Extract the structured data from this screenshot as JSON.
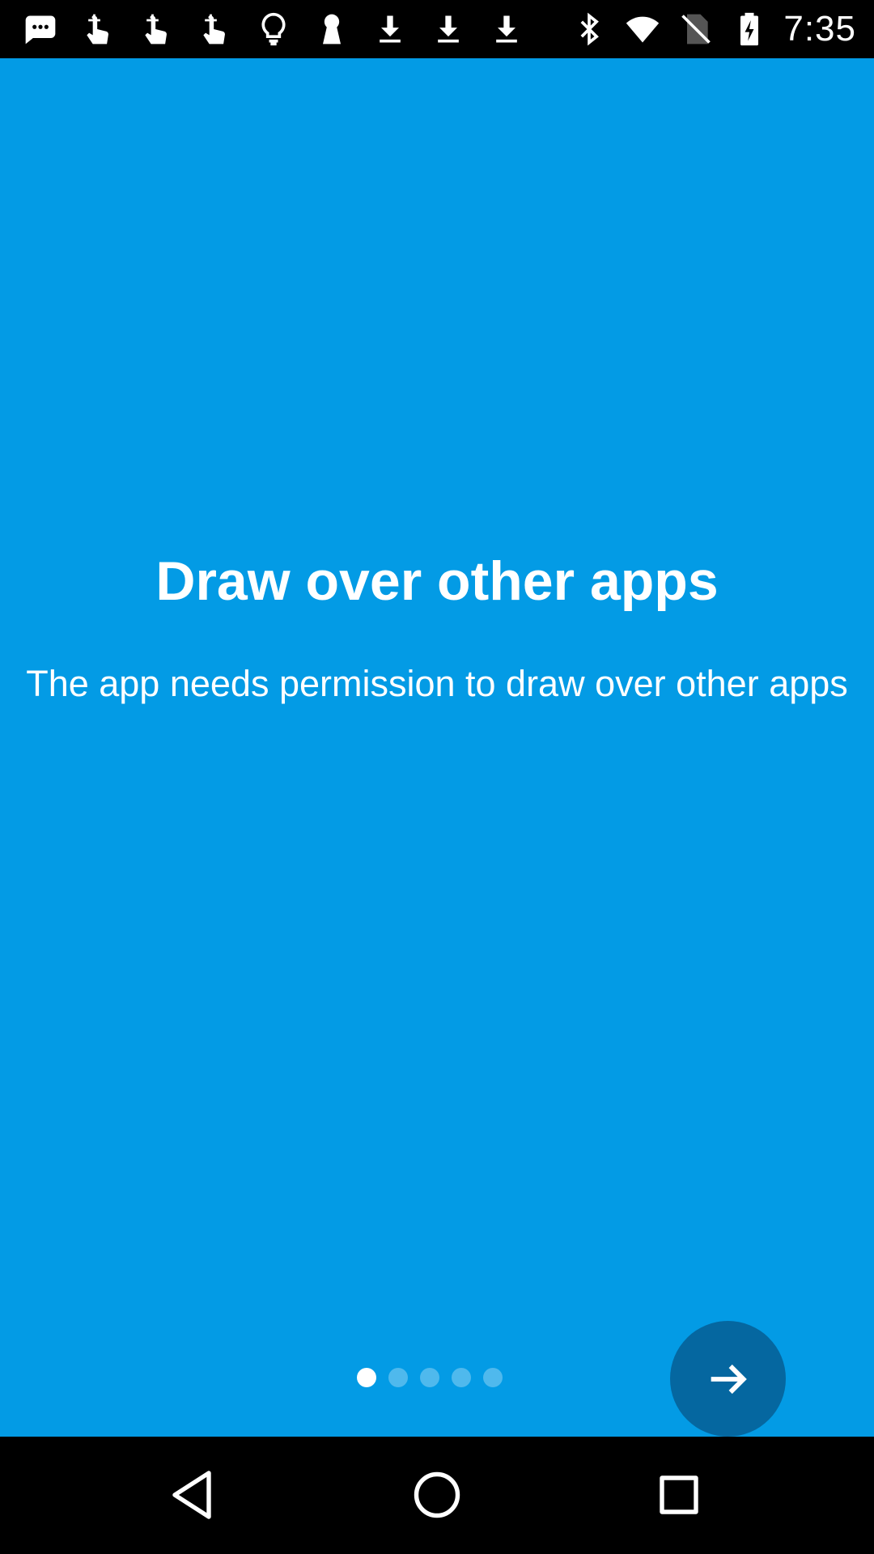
{
  "status_bar": {
    "time": "7:35",
    "left_icons": [
      "message-icon",
      "touch-icon",
      "touch-icon",
      "touch-icon",
      "lightbulb-icon",
      "keyhole-icon",
      "download-icon",
      "download-icon",
      "download-icon"
    ],
    "right_icons": [
      "bluetooth-icon",
      "wifi-icon",
      "no-sim-icon",
      "battery-charging-icon"
    ]
  },
  "onboarding": {
    "title": "Draw over other apps",
    "description": "The app needs permission to draw over other apps",
    "page_count": 5,
    "current_page": 1
  },
  "colors": {
    "background": "#039be5",
    "next_button": "#0567a0"
  },
  "nav_bar": {
    "buttons": [
      "back",
      "home",
      "recents"
    ]
  }
}
